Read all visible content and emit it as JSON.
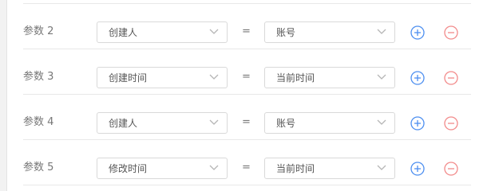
{
  "colors": {
    "add_icon": "#4d8ff0",
    "remove_icon": "#f28a8a",
    "border": "#d9d9d9",
    "label_text": "#777777"
  },
  "operator": "=",
  "rows": [
    {
      "label": "参数 2",
      "field": "创建人",
      "value": "账号"
    },
    {
      "label": "参数 3",
      "field": "创建时间",
      "value": "当前时间"
    },
    {
      "label": "参数 4",
      "field": "创建人",
      "value": "账号"
    },
    {
      "label": "参数 5",
      "field": "修改时间",
      "value": "当前时间"
    }
  ],
  "icons": {
    "add": "plus-circle-icon",
    "remove": "minus-circle-icon",
    "dropdown": "chevron-down-icon"
  }
}
